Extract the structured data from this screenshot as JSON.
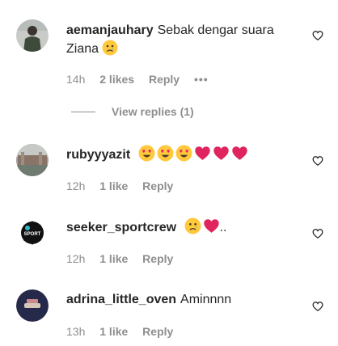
{
  "comments": [
    {
      "username": "aemanjauhary",
      "text": "Sebak dengar suara Ziana",
      "emoji": [
        "sad-face"
      ],
      "time": "14h",
      "likes": "2 likes",
      "reply": "Reply",
      "more": "•••",
      "view_replies": "View replies (1)"
    },
    {
      "username": "rubyyyazit",
      "text": "",
      "emoji": [
        "heart-eyes",
        "heart-eyes",
        "heart-eyes",
        "red-heart",
        "red-heart",
        "red-heart"
      ],
      "time": "12h",
      "likes": "1 like",
      "reply": "Reply"
    },
    {
      "username": "seeker_sportcrew",
      "text": "",
      "suffix": "..",
      "emoji": [
        "sad-face",
        "red-heart"
      ],
      "time": "12h",
      "likes": "1 like",
      "reply": "Reply"
    },
    {
      "username": "adrina_little_oven",
      "text": "Aminnnn",
      "emoji": [],
      "time": "13h",
      "likes": "1 like",
      "reply": "Reply"
    }
  ],
  "colors": {
    "text": "#262626",
    "muted": "#8e8e8e",
    "emoji_yellow": "#FFC83D",
    "heart_red": "#E0245E"
  }
}
